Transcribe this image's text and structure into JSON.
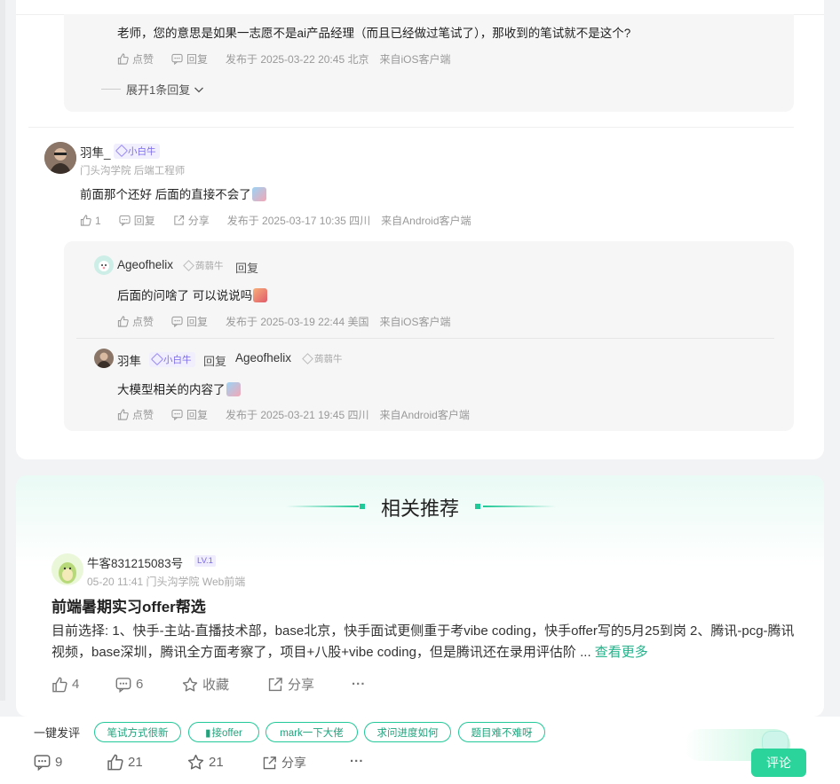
{
  "comments": {
    "top_reply": {
      "text": "老师，您的意思是如果一志愿不是ai产品经理（而且已经做过笔试了），那收到的笔试就不是这个?",
      "like": "点赞",
      "reply": "回复",
      "time": "发布于 2025-03-22 20:45 北京",
      "client": "来自iOS客户端",
      "expand": "展开1条回复"
    },
    "main": {
      "user": "羽隼_",
      "badge": "小白牛",
      "org": "门头沟学院 后端工程师",
      "text": "前面那个还好 后面的直接不会了",
      "likes": "1",
      "reply": "回复",
      "share": "分享",
      "time": "发布于 2025-03-17 10:35 四川",
      "client": "来自Android客户端"
    },
    "reply1": {
      "user": "Ageofhelix",
      "badge": "蒟蒻牛",
      "reply_word": "回复",
      "text": "后面的问啥了 可以说说吗",
      "like": "点赞",
      "reply": "回复",
      "time": "发布于 2025-03-19 22:44 美国",
      "client": "来自iOS客户端"
    },
    "reply2": {
      "user": "羽隼",
      "badge": "小白牛",
      "reply_word": "回复",
      "target": "Ageofhelix",
      "target_badge": "蒟蒻牛",
      "text": "大模型相关的内容了",
      "like": "点赞",
      "reply": "回复",
      "time": "发布于 2025-03-21 19:45 四川",
      "client": "来自Android客户端"
    }
  },
  "related": {
    "heading": "相关推荐",
    "post": {
      "user": "牛客831215083号",
      "level": "LV.1",
      "meta": "05-20 11:41  门头沟学院 Web前端",
      "title": "前端暑期实习offer帮选",
      "body": "目前选择: 1、快手-主站-直播技术部，base北京，快手面试更侧重于考vibe coding，快手offer写的5月25到岗 2、腾讯-pcg-腾讯视频，base深圳，腾讯全方面考察了，项目+八股+vibe coding，但是腾讯还在录用评估阶 ...",
      "more": "查看更多",
      "likes": "4",
      "comments": "6",
      "collect": "收藏",
      "share": "分享",
      "more_icon": "..."
    }
  },
  "bottom_bar": {
    "quick_label": "一键发评",
    "chips": [
      "笔试方式很新",
      "接offer",
      "mark一下大佬",
      "求问进度如何",
      "题目难不难呀"
    ],
    "comments": "9",
    "likes": "21",
    "stars": "21",
    "share": "分享",
    "more": "...",
    "comment_button": "评论"
  },
  "colors": {
    "accent": "#20c997",
    "badge_purple": "#7b6be8",
    "link": "#20b28a"
  }
}
